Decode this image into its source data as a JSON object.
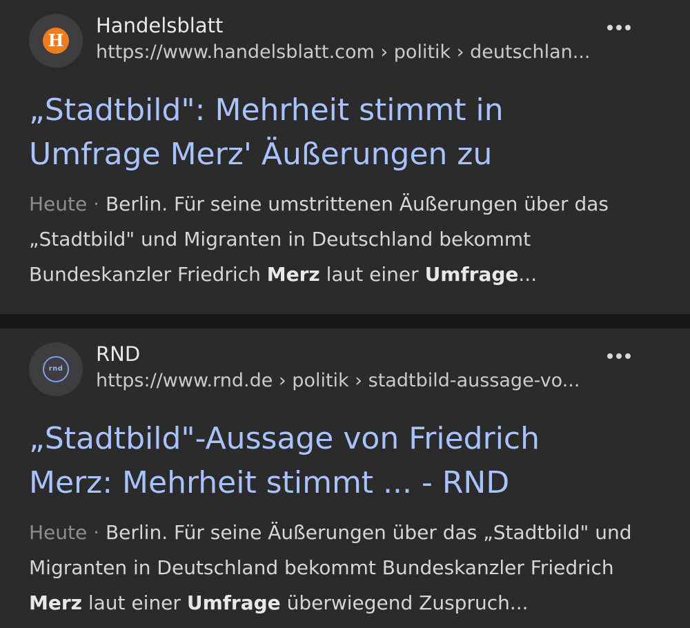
{
  "results": [
    {
      "source_name": "Handelsblatt",
      "favicon_letter": "H",
      "favicon_color": "#f07d1d",
      "url": "https://www.handelsblatt.com › politik › deutschlan...",
      "title_line1": "„Stadtbild\": Mehrheit stimmt in",
      "title_line2": "Umfrage Merz' Äußerungen zu",
      "date": "Heute",
      "separator": "·",
      "snippet_parts": [
        " Berlin. Für seine umstrittenen Äußerungen über das „Stadtbild\" und Migranten in Deutschland bekommt Bundeskanzler Friedrich ",
        "Merz",
        " laut einer ",
        "Umfrage",
        "..."
      ]
    },
    {
      "source_name": "RND",
      "favicon_letter": "rnd",
      "favicon_color": "#7fa0ee",
      "url": "https://www.rnd.de › politik › stadtbild-aussage-vo...",
      "title_line1": "„Stadtbild\"-Aussage von Friedrich",
      "title_line2": "Merz: Mehrheit stimmt ... - RND",
      "date": "Heute",
      "separator": "·",
      "snippet_parts": [
        " Berlin. Für seine Äußerungen über das „Stadtbild\" und Migranten in Deutschland bekommt Bundeskanzler Friedrich ",
        "Merz",
        " laut einer ",
        "Umfrage",
        " überwiegend Zuspruch..."
      ]
    }
  ],
  "colors": {
    "background": "#161617",
    "card": "#2b2b2c",
    "title_link": "#a8c3ff"
  }
}
